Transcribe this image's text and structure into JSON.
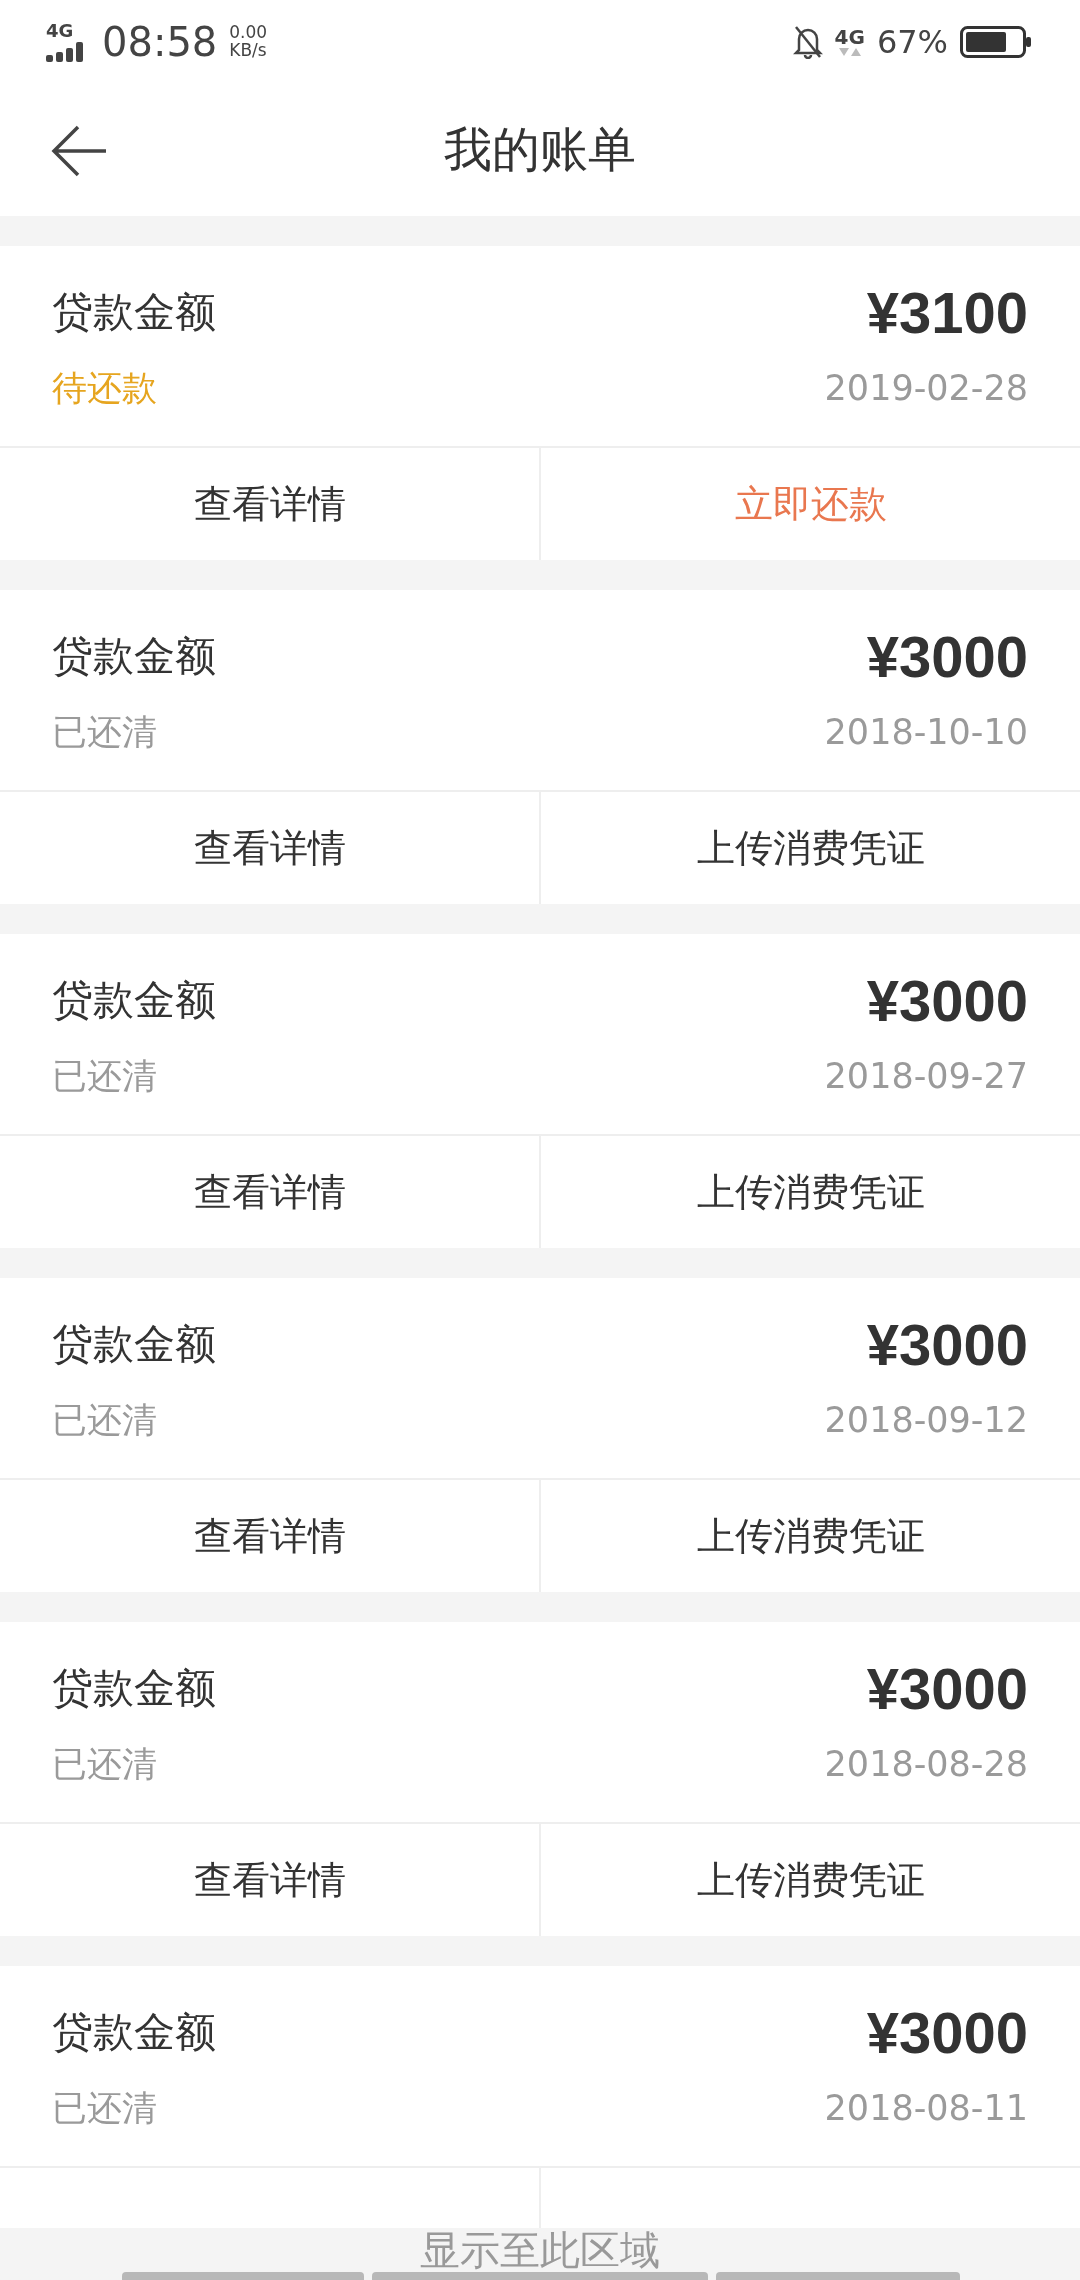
{
  "status_bar": {
    "network": "4G",
    "time": "08:58",
    "speed_value": "0.00",
    "speed_unit": "KB/s",
    "data_network": "4G",
    "battery": "67%"
  },
  "header": {
    "title": "我的账单"
  },
  "bills": [
    {
      "label": "贷款金额",
      "amount": "¥3100",
      "status": "待还款",
      "repaid": false,
      "date": "2019-02-28",
      "actions": [
        {
          "label": "查看详情",
          "kind": "normal"
        },
        {
          "label": "立即还款",
          "kind": "primary"
        }
      ]
    },
    {
      "label": "贷款金额",
      "amount": "¥3000",
      "status": "已还清",
      "repaid": true,
      "date": "2018-10-10",
      "actions": [
        {
          "label": "查看详情",
          "kind": "normal"
        },
        {
          "label": "上传消费凭证",
          "kind": "normal"
        }
      ]
    },
    {
      "label": "贷款金额",
      "amount": "¥3000",
      "status": "已还清",
      "repaid": true,
      "date": "2018-09-27",
      "actions": [
        {
          "label": "查看详情",
          "kind": "normal"
        },
        {
          "label": "上传消费凭证",
          "kind": "normal"
        }
      ]
    },
    {
      "label": "贷款金额",
      "amount": "¥3000",
      "status": "已还清",
      "repaid": true,
      "date": "2018-09-12",
      "actions": [
        {
          "label": "查看详情",
          "kind": "normal"
        },
        {
          "label": "上传消费凭证",
          "kind": "normal"
        }
      ]
    },
    {
      "label": "贷款金额",
      "amount": "¥3000",
      "status": "已还清",
      "repaid": true,
      "date": "2018-08-28",
      "actions": [
        {
          "label": "查看详情",
          "kind": "normal"
        },
        {
          "label": "上传消费凭证",
          "kind": "normal"
        }
      ]
    },
    {
      "label": "贷款金额",
      "amount": "¥3000",
      "status": "已还清",
      "repaid": true,
      "date": "2018-08-11",
      "actions": [
        {
          "kind": "normal"
        },
        {
          "kind": "normal"
        }
      ]
    }
  ],
  "capture_overlay": {
    "text": "显示至此区域"
  }
}
